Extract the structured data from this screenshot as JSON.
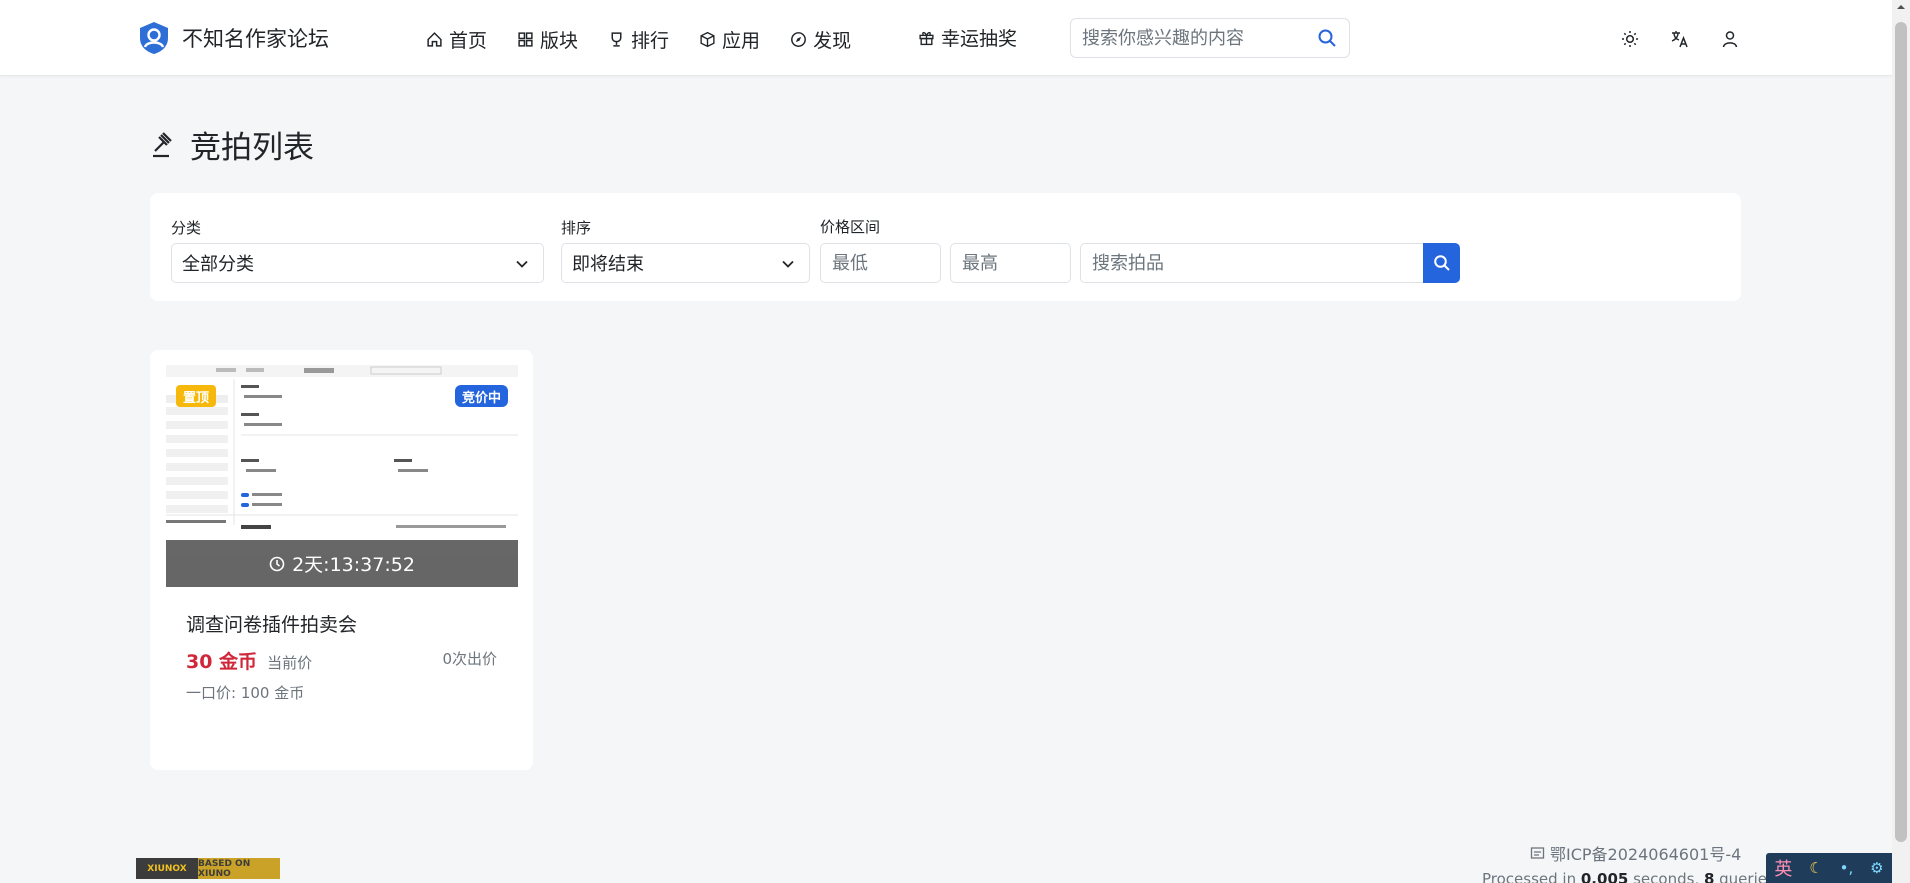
{
  "site": {
    "name": "不知名作家论坛"
  },
  "nav": {
    "items": [
      {
        "label": "首页",
        "icon": "home-icon"
      },
      {
        "label": "版块",
        "icon": "grid-icon"
      },
      {
        "label": "排行",
        "icon": "trophy-icon"
      },
      {
        "label": "应用",
        "icon": "box-icon"
      },
      {
        "label": "发现",
        "icon": "compass-icon"
      }
    ],
    "lucky": {
      "label": "幸运抽奖",
      "icon": "gift-icon"
    }
  },
  "search": {
    "placeholder": "搜索你感兴趣的内容"
  },
  "page": {
    "title": "竞拍列表"
  },
  "filters": {
    "category": {
      "label": "分类",
      "value": "全部分类"
    },
    "sort": {
      "label": "排序",
      "value": "即将结束"
    },
    "price_range": {
      "label": "价格区间",
      "min_placeholder": "最低",
      "max_placeholder": "最高"
    },
    "search_placeholder": "搜索拍品"
  },
  "auctions": [
    {
      "badge_top": "置顶",
      "badge_status": "竞价中",
      "countdown": "2天:13:37:52",
      "title": "调查问卷插件拍卖会",
      "price": "30 金币",
      "price_label": "当前价",
      "bids": "0次出价",
      "buyout": "一口价: 100 金币"
    }
  ],
  "footer": {
    "badge_left": "XIUNOX",
    "badge_right": "BASED ON XIUNO",
    "icp": "鄂ICP备2024064601号-4",
    "processed_prefix": "Processed in ",
    "seconds": "0.005",
    "seconds_suffix": " seconds, ",
    "queries": "8",
    "queries_suffix": " queries"
  },
  "ime": {
    "lang": "英"
  },
  "colors": {
    "primary": "#2464dd",
    "price": "#d0283a",
    "top_badge": "#f6b90b"
  }
}
